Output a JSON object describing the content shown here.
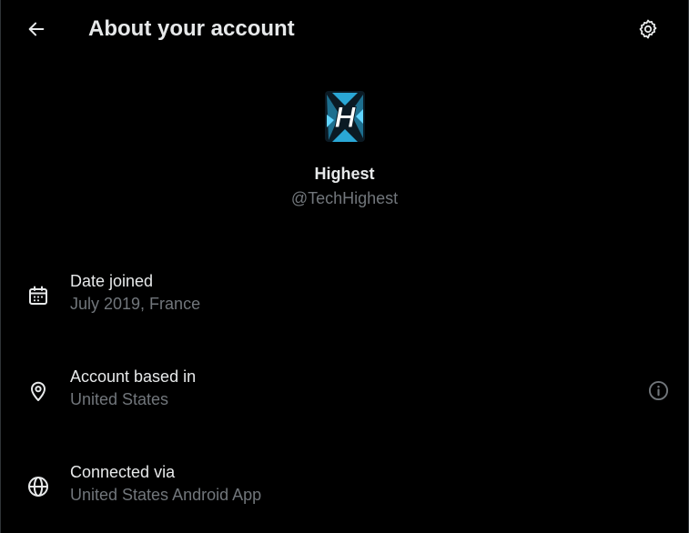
{
  "header": {
    "title": "About your account",
    "back_icon": "arrow-left-icon",
    "settings_icon": "gear-icon"
  },
  "profile": {
    "display_name": "Highest",
    "handle": "@TechHighest",
    "avatar_letter": "H"
  },
  "rows": [
    {
      "icon": "calendar-icon",
      "label": "Date joined",
      "value": "July 2019, France"
    },
    {
      "icon": "location-pin-icon",
      "label": "Account based in",
      "value": "United States",
      "info_icon": "info-icon"
    },
    {
      "icon": "globe-icon",
      "label": "Connected via",
      "value": "United States Android App"
    }
  ],
  "colors": {
    "background": "#000000",
    "primary_text": "#e7e9ea",
    "secondary_text": "#71767b",
    "avatar_accent": "#1da1f2"
  }
}
